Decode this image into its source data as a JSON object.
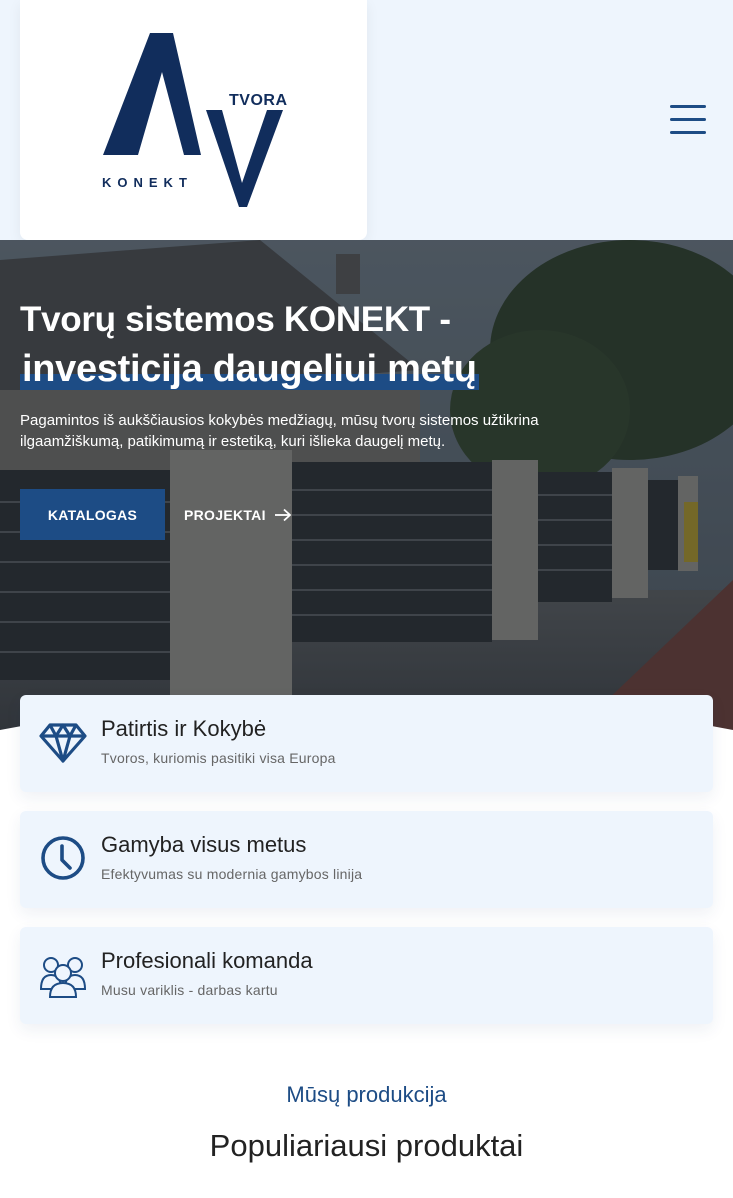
{
  "header": {
    "logo": {
      "brand_top": "TVORA",
      "brand_bottom": "KONEKT"
    },
    "menu_icon": "hamburger-menu-icon"
  },
  "hero": {
    "title_line1": "Tvorų sistemos KONEKT -",
    "title_line2": "investicija daugeliui metų",
    "subtitle": "Pagamintos iš aukščiausios kokybės medžiagų, mūsų tvorų sistemos užtikrina ilgaamžiškumą, patikimumą ir estetiką, kuri išlieka daugelį metų.",
    "primary_button": "KATALOGAS",
    "secondary_button": "PROJEKTAI",
    "secondary_icon": "arrow-right-icon"
  },
  "features": [
    {
      "title": "Patirtis ir Kokybė",
      "subtitle": "Tvoros, kuriomis pasitiki visa Europa",
      "icon": "diamond-icon"
    },
    {
      "title": "Gamyba visus metus",
      "subtitle": "Efektyvumas su modernia gamybos linija",
      "icon": "clock-icon"
    },
    {
      "title": "Profesionali komanda",
      "subtitle": "Musu variklis - darbas kartu",
      "icon": "team-icon"
    }
  ],
  "products_section": {
    "kicker": "Mūsų produkcija",
    "title": "Populiariausi produktai"
  },
  "colors": {
    "brand_blue": "#1d4c85",
    "logo_navy": "#112d5c",
    "light_bg": "#eef5fd"
  }
}
